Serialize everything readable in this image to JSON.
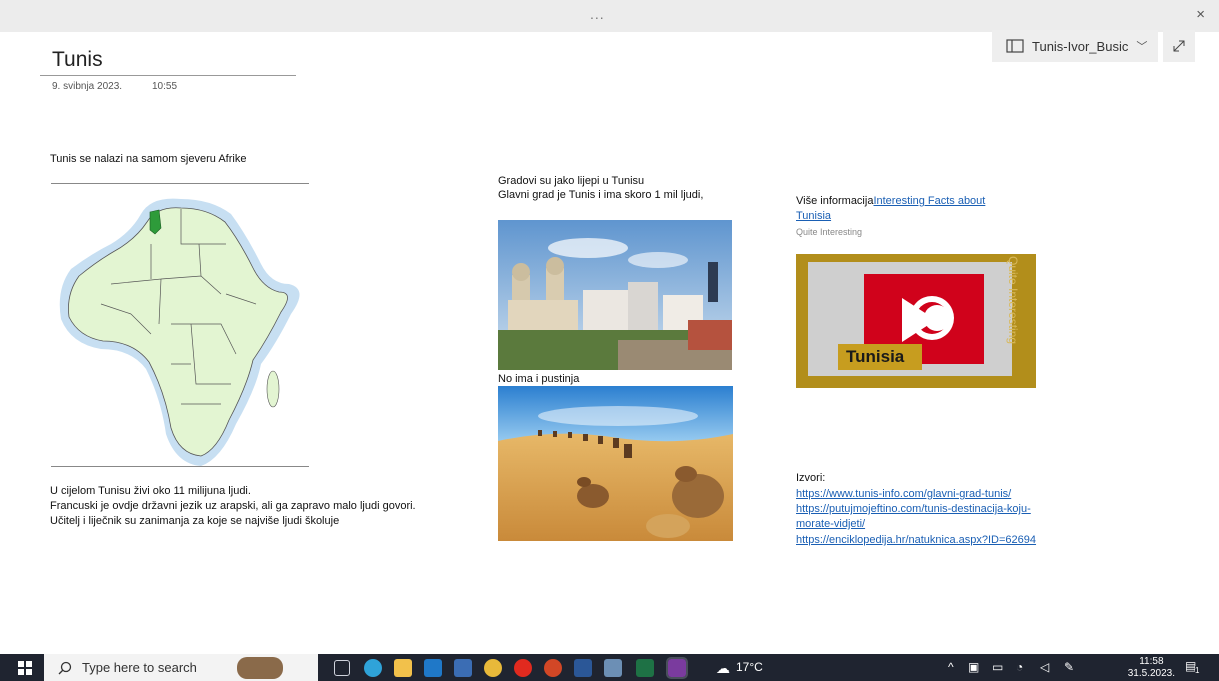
{
  "window": {
    "title_dots": "...",
    "close_label": "×"
  },
  "notebook": {
    "name": "Tunis-Ivor_Busic"
  },
  "page": {
    "title": "Tunis",
    "date": "9. svibnja 2023.",
    "time": "10:55"
  },
  "content": {
    "intro": "Tunis se nalazi na samom sjeveru Afrike",
    "population": [
      "U cijelom Tunisu živi oko 11 milijuna ljudi.",
      "Francuski je ovdje državni jezik uz arapski, ali ga zapravo malo ljudi govori.",
      "Učitelj i liječnik su zanimanja za koje se najviše ljudi školuje"
    ],
    "cities_line1": "Gradovi su jako lijepi u Tunisu",
    "cities_line2": "Glavni grad je Tunis i ima skoro 1 mil ljudi,",
    "desert": "No ima i pustinja",
    "more_info_prefix": "Više informacija",
    "more_info_link_1": "Interesting Facts about",
    "more_info_link_2": "Tunisia",
    "more_info_source": "Quite Interesting",
    "video_label": "Tunisia",
    "video_side": "Quite Interesting",
    "sources_label": "Izvori:",
    "sources": [
      "https://www.tunis-info.com/glavni-grad-tunis/",
      "https://putujmojeftino.com/tunis-destinacija-koju-",
      "morate-vidjeti/",
      "https://enciklopedija.hr/natuknica.aspx?ID=62694"
    ]
  },
  "taskbar": {
    "search_placeholder": "Type here to search",
    "temperature": "17°C",
    "clock_time": "11:58",
    "clock_date": "31.5.2023.",
    "notif_count": "1"
  },
  "colors": {
    "map_land": "#e3f5d2",
    "map_sea": "#c7dff2",
    "tunisia": "#2e9b3a",
    "video_gold": "#b28e1b",
    "flag_red": "#d0021b",
    "taskbar_bg": "#1f2430"
  }
}
